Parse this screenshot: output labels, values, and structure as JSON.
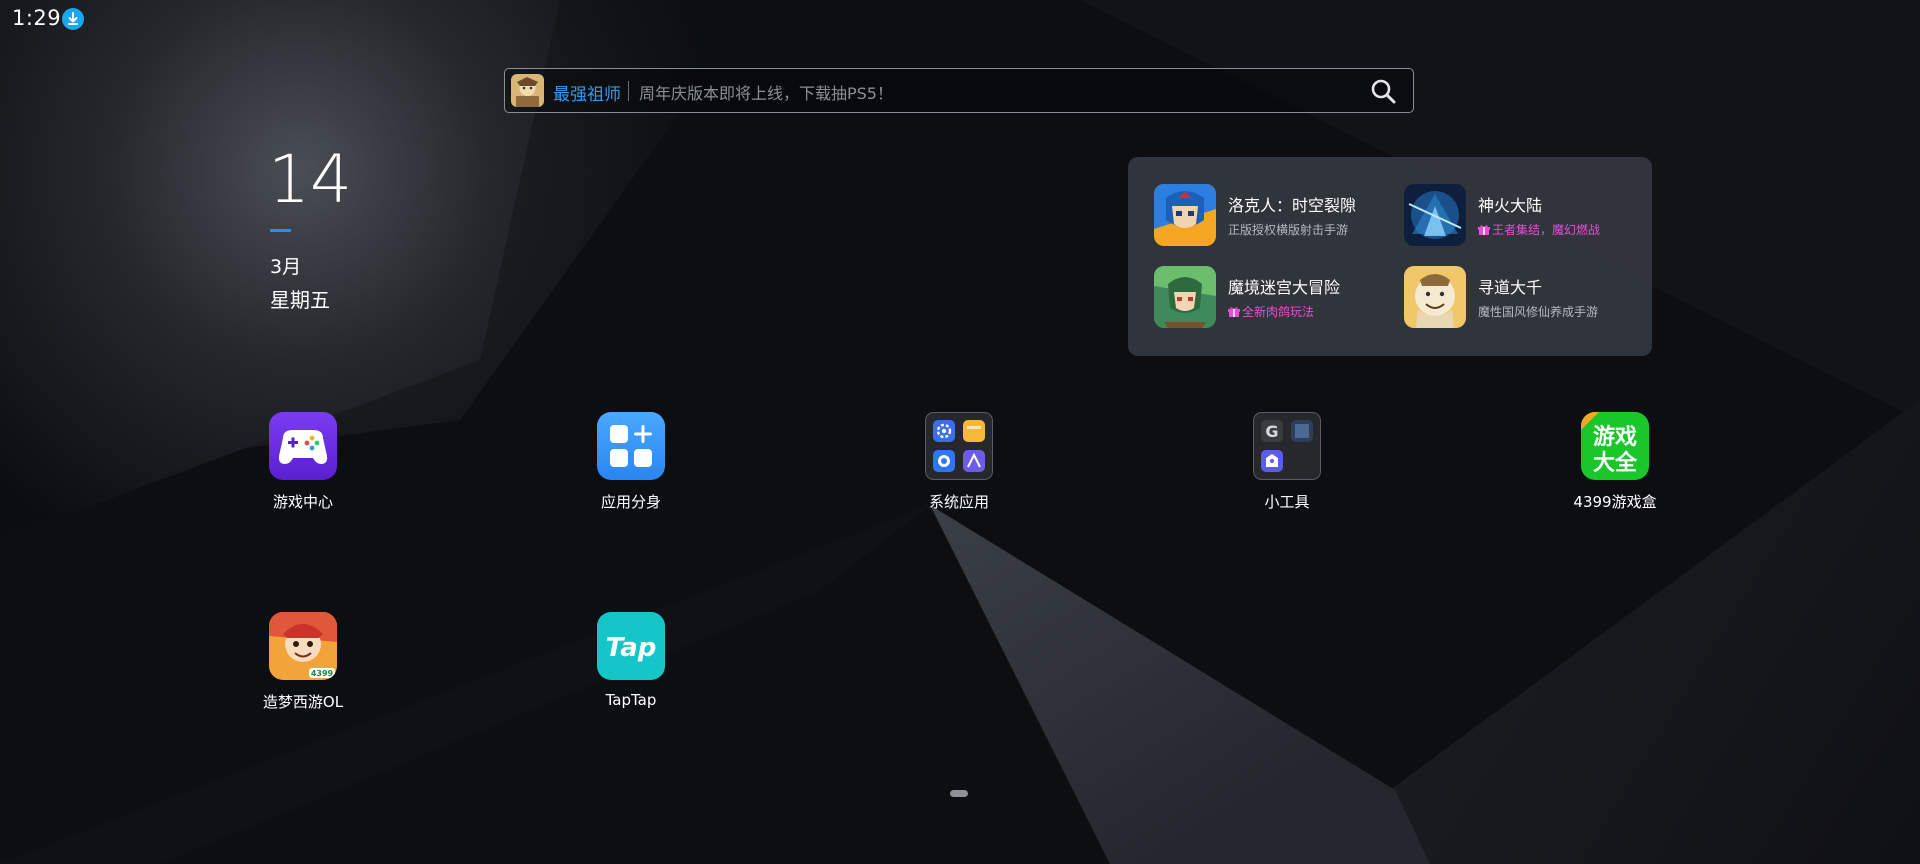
{
  "status_bar": {
    "time": "1:29",
    "download_icon": "download-arrow-icon",
    "download_color": "#19a7ef"
  },
  "search": {
    "game_name": "最强祖师",
    "hint": "周年庆版本即将上线，下载抽PS5！",
    "search_icon": "search-icon",
    "accent_color": "#2c9cf5"
  },
  "date_widget": {
    "day": "14",
    "month": "3月",
    "weekday": "星期五",
    "accent_color": "#1d95f0"
  },
  "recommendations": [
    {
      "title": "洛克人：时空裂隙",
      "subtitle": "正版授权横版射击手游",
      "promo": false
    },
    {
      "title": "神火大陆",
      "subtitle": "王者集结，魔幻燃战",
      "promo": true
    },
    {
      "title": "魔境迷宫大冒险",
      "subtitle": "全新肉鸽玩法",
      "promo": true
    },
    {
      "title": "寻道大千",
      "subtitle": "魔性国风修仙养成手游",
      "promo": false
    }
  ],
  "apps": [
    {
      "label": "游戏中心",
      "icon": "gamepad-icon"
    },
    {
      "label": "应用分身",
      "icon": "app-clone-icon"
    },
    {
      "label": "系统应用",
      "icon": "system-apps-folder-icon"
    },
    {
      "label": "小工具",
      "icon": "tools-folder-icon"
    },
    {
      "label": "4399游戏盒",
      "icon": "4399-game-box-icon",
      "icon_text_1": "游戏",
      "icon_text_2": "大全"
    },
    {
      "label": "造梦西游OL",
      "icon": "zaomeng-xiyou-icon",
      "icon_badge": "4399"
    },
    {
      "label": "TapTap",
      "icon": "taptap-icon",
      "icon_text": "Tap"
    }
  ],
  "promo_color": "#e54fd6"
}
